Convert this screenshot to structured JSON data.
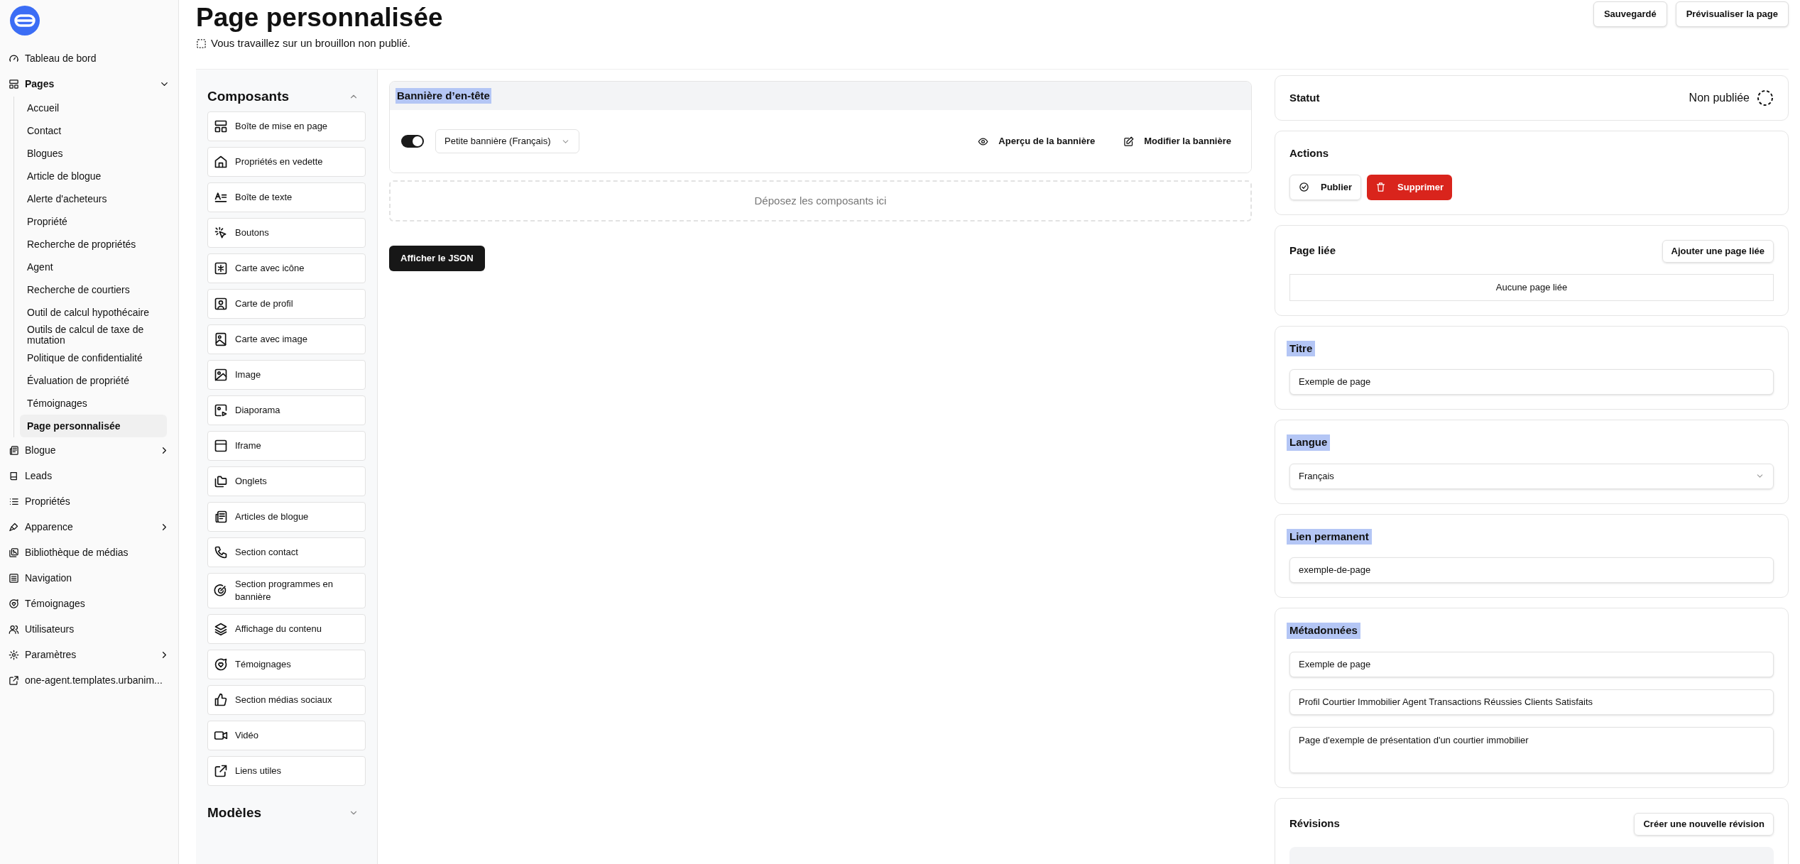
{
  "sidebar": {
    "items": [
      {
        "label": "Tableau de bord"
      },
      {
        "label": "Pages",
        "expanded": true,
        "children": [
          {
            "label": "Accueil",
            "selected": false
          },
          {
            "label": "Contact",
            "selected": false
          },
          {
            "label": "Blogues",
            "selected": false
          },
          {
            "label": "Article de blogue",
            "selected": false
          },
          {
            "label": "Alerte d'acheteurs",
            "selected": false
          },
          {
            "label": "Propriété",
            "selected": false
          },
          {
            "label": "Recherche de propriétés",
            "selected": false
          },
          {
            "label": "Agent",
            "selected": false
          },
          {
            "label": "Recherche de courtiers",
            "selected": false
          },
          {
            "label": "Outil de calcul hypothécaire",
            "selected": false
          },
          {
            "label": "Outils de calcul de taxe de mutation",
            "selected": false
          },
          {
            "label": "Politique de confidentialité",
            "selected": false
          },
          {
            "label": "Évaluation de propriété",
            "selected": false
          },
          {
            "label": "Témoignages",
            "selected": false
          },
          {
            "label": "Page personnalisée",
            "selected": true
          }
        ]
      },
      {
        "label": "Blogue",
        "expanded": false
      },
      {
        "label": "Leads"
      },
      {
        "label": "Propriétés"
      },
      {
        "label": "Apparence",
        "expanded": false
      },
      {
        "label": "Bibliothèque de médias"
      },
      {
        "label": "Navigation"
      },
      {
        "label": "Témoignages"
      },
      {
        "label": "Utilisateurs"
      },
      {
        "label": "Paramètres",
        "expanded": false
      },
      {
        "label": "one-agent.templates.urbanim..."
      }
    ]
  },
  "header": {
    "title": "Page personnalisée",
    "subtitle": "Vous travaillez sur un brouillon non publié.",
    "buttons": [
      "Sauvegardé",
      "Prévisualiser la page"
    ]
  },
  "components_panel": {
    "sections": [
      {
        "title": "Composants",
        "expanded": true,
        "items": [
          "Boîte de mise en page",
          "Propriétés en vedette",
          "Boîte de texte",
          "Boutons",
          "Carte avec icône",
          "Carte de profil",
          "Carte avec image",
          "Image",
          "Diaporama",
          "Iframe",
          "Onglets",
          "Articles de blogue",
          "Section contact",
          "Section programmes en bannière",
          "Affichage du contenu",
          "Témoignages",
          "Section médias sociaux",
          "Vidéo",
          "Liens utiles"
        ]
      },
      {
        "title": "Modèles",
        "expanded": false
      }
    ]
  },
  "editor": {
    "banner": {
      "title": "Bannière d’en-tête",
      "highlighted": true,
      "on": true,
      "variant": "Petite bannière (Français)",
      "actions": [
        "Aperçu de la bannière",
        "Modifier la bannière"
      ]
    },
    "dropzone": "Déposez les composants ici",
    "json_button": "Afficher le JSON"
  },
  "cards": [
    {
      "kind": "status",
      "title": "Statut",
      "highlighted": false,
      "value": "Non publiée"
    },
    {
      "kind": "actions",
      "title": "Actions",
      "highlighted": false,
      "buttons": [
        "Publier",
        "Supprimer"
      ]
    },
    {
      "kind": "linked",
      "title": "Page liée",
      "highlighted": false,
      "button": "Ajouter une page liée",
      "empty": "Aucune page liée"
    },
    {
      "kind": "field",
      "title": "Titre",
      "highlighted": true,
      "value": "Exemple de page"
    },
    {
      "kind": "select",
      "title": "Langue",
      "highlighted": true,
      "value": "Français"
    },
    {
      "kind": "field",
      "title": "Lien permanent",
      "highlighted": true,
      "value": "exemple-de-page"
    },
    {
      "kind": "meta",
      "title": "Métadonnées",
      "highlighted": true,
      "fields": [
        "Exemple de page",
        "Profil Courtier Immobilier Agent Transactions Réussies Clients Satisfaits"
      ],
      "description": "Page d'exemple de présentation d'un courtier immobilier"
    },
    {
      "kind": "revisions",
      "title": "Révisions",
      "highlighted": false,
      "button": "Créer une nouvelle révision"
    }
  ]
}
